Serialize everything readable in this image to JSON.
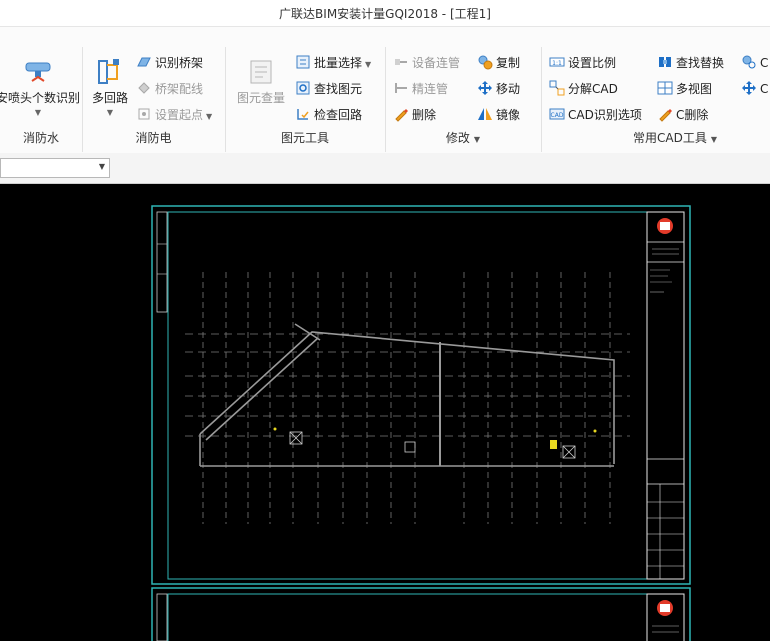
{
  "window": {
    "title": "广联达BIM安装计量GQI2018 - [工程1]"
  },
  "ribbon": {
    "groups": [
      {
        "label": "消防水",
        "buttons": [
          "安喷头个数识别"
        ]
      },
      {
        "label": "消防电",
        "buttons": [
          "多回路",
          "识别桥架",
          "桥架配线",
          "设置起点"
        ]
      },
      {
        "label": "图元工具",
        "buttons": [
          "图元查量",
          "批量选择",
          "查找图元",
          "检查回路"
        ]
      },
      {
        "label": "修改",
        "buttons": [
          "设备连管",
          "精连管",
          "删除",
          "复制",
          "移动",
          "镜像"
        ]
      },
      {
        "label": "常用CAD工具",
        "buttons": [
          "设置比例",
          "分解CAD",
          "CAD识别选项",
          "查找替换",
          "多视图",
          "C删除",
          "C",
          "C"
        ]
      }
    ]
  },
  "toolbar": {
    "combo_value": ""
  },
  "colors": {
    "frame": "#2fb6b6",
    "linework": "#8c8c8c",
    "background": "#000000",
    "ribbon": "#fbfbfb",
    "accent": "#1e6fc6"
  },
  "icons": [
    "sprinkler-icon",
    "multi-loop-icon",
    "tray-icon",
    "tray-wire-icon",
    "start-point-icon",
    "element-query-icon",
    "batch-select-icon",
    "find-element-icon",
    "check-loop-icon",
    "pipe-connect-icon",
    "delete-icon",
    "copy-icon",
    "move-icon",
    "mirror-icon",
    "scale-icon",
    "explode-icon",
    "cad-option-icon",
    "find-replace-icon",
    "multi-view-icon",
    "c-delete-icon"
  ]
}
